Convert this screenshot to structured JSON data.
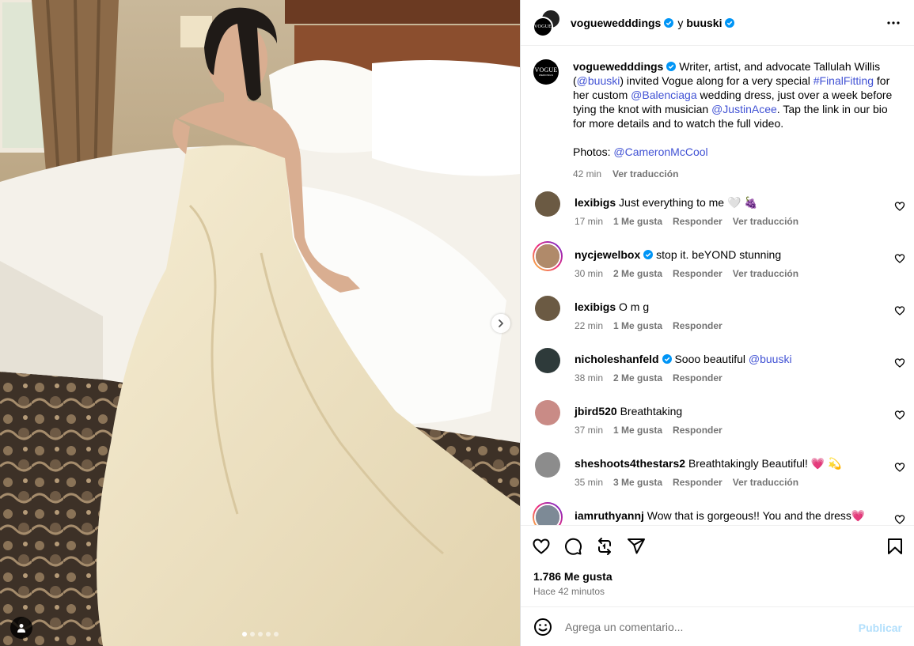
{
  "post": {
    "author": "voguewedddings",
    "author_display": "voguewedddings",
    "coauthor": "buuski",
    "and_text": "y",
    "avatar_text": "VOGUE",
    "avatar_subtext": "WEDDINGS"
  },
  "caption": {
    "username": "voguewedddings",
    "parts": [
      "Writer, artist, and advocate Tallulah Willis (",
      "@buuski",
      ") invited Vogue along for a very special ",
      "#FinalFitting",
      " for her custom ",
      "@Balenciaga",
      " wedding dress, just over a week before tying the knot with musician ",
      "@JustinAcee",
      ". Tap the link in our bio for more details and to watch the full video."
    ],
    "photos_label": "Photos: ",
    "photos_credit": "@CameronMcCool",
    "time": "42 min",
    "translate": "Ver traducción"
  },
  "comments": [
    {
      "user": "lexibigs",
      "text": "Just everything to me 🤍 🍇",
      "time": "17 min",
      "likes": "1 Me gusta",
      "reply": "Responder",
      "translate": "Ver traducción",
      "verified": false,
      "ring": false,
      "avatar_color": "#6b5a43"
    },
    {
      "user": "nycjewelbox",
      "text": "stop it. beYOND stunning",
      "time": "30 min",
      "likes": "2 Me gusta",
      "reply": "Responder",
      "translate": "Ver traducción",
      "verified": true,
      "ring": true,
      "avatar_color": "#b08a6a"
    },
    {
      "user": "lexibigs",
      "text": "O m g",
      "time": "22 min",
      "likes": "1 Me gusta",
      "reply": "Responder",
      "translate": "",
      "verified": false,
      "ring": false,
      "avatar_color": "#6b5a43"
    },
    {
      "user": "nicholeshanfeld",
      "text": "Sooo beautiful ",
      "mention": "@buuski",
      "time": "38 min",
      "likes": "2 Me gusta",
      "reply": "Responder",
      "translate": "",
      "verified": true,
      "ring": false,
      "avatar_color": "#2e3a3a"
    },
    {
      "user": "jbird520",
      "text": "Breathtaking",
      "time": "37 min",
      "likes": "1 Me gusta",
      "reply": "Responder",
      "translate": "",
      "verified": false,
      "ring": false,
      "avatar_color": "#c98b86"
    },
    {
      "user": "sheshoots4thestars2",
      "text": "Breathtakingly Beautiful! 💗 💫",
      "time": "35 min",
      "likes": "3 Me gusta",
      "reply": "Responder",
      "translate": "Ver traducción",
      "verified": false,
      "ring": false,
      "avatar_color": "#8c8c8c"
    },
    {
      "user": "iamruthyannj",
      "text": "Wow that is gorgeous!! You and the dress💗",
      "time": "",
      "likes": "",
      "reply": "",
      "translate": "",
      "verified": false,
      "ring": true,
      "avatar_color": "#7d8a96"
    }
  ],
  "stats": {
    "likes": "1.786 Me gusta",
    "time": "Hace 42 minutos"
  },
  "composer": {
    "placeholder": "Agrega un comentario...",
    "post_label": "Publicar"
  },
  "carousel": {
    "count": 5,
    "active_index": 0
  },
  "colors": {
    "link": "#4152d4",
    "verified": "#0095f6",
    "muted": "#737373",
    "post_disabled": "#b2dffc"
  },
  "icons": [
    "heart-icon",
    "comment-icon",
    "repost-icon",
    "share-icon",
    "bookmark-icon",
    "more-icon",
    "emoji-icon",
    "chevron-right-icon",
    "user-tag-icon",
    "verified-icon"
  ]
}
